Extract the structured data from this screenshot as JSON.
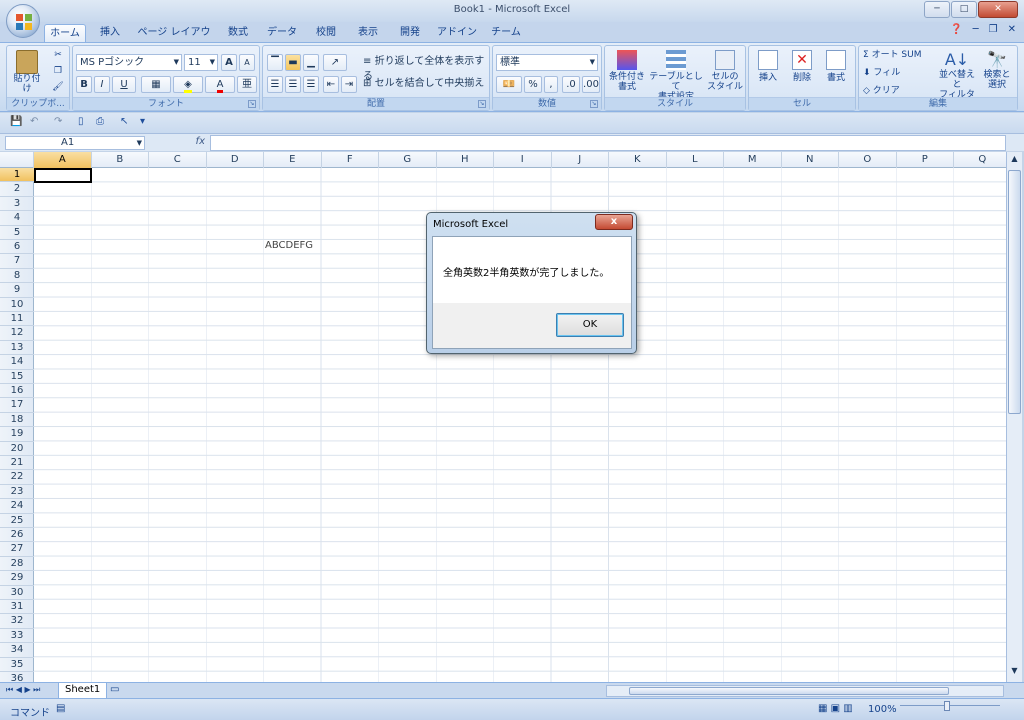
{
  "window": {
    "title": "Book1 - Microsoft Excel",
    "buttons": {
      "minimize": "─",
      "maximize": "□",
      "close": "✕"
    }
  },
  "tabs": [
    "ホーム",
    "挿入",
    "ページ レイアウト",
    "数式",
    "データ",
    "校閲",
    "表示",
    "開発",
    "アドイン",
    "チーム"
  ],
  "ribbon": {
    "clipboard": {
      "paste": "貼り付け",
      "label": "クリップボ..."
    },
    "font": {
      "name": "MS Pゴシック",
      "size": "11",
      "label": "フォント",
      "bold": "B",
      "italic": "I",
      "underline": "U",
      "grow": "A",
      "shrink": "A"
    },
    "alignment": {
      "wrap": "折り返して全体を表示する",
      "merge": "セルを結合して中央揃え",
      "label": "配置"
    },
    "number": {
      "format": "標準",
      "percent": "%",
      "comma": ",",
      "label": "数値"
    },
    "styles": {
      "conditional": "条件付き\n書式",
      "table": "テーブルとして\n書式設定",
      "cell": "セルの\nスタイル",
      "label": "スタイル"
    },
    "cells": {
      "insert": "挿入",
      "delete": "削除",
      "format": "書式",
      "label": "セル"
    },
    "editing": {
      "autosum": "オート SUM",
      "fill": "フィル",
      "clear": "クリア",
      "sort": "並べ替えと\nフィルタ",
      "find": "検索と\n選択",
      "label": "編集"
    }
  },
  "formula_bar": {
    "name_box": "A1",
    "fx": "fx",
    "value": ""
  },
  "columns": [
    "A",
    "B",
    "C",
    "D",
    "E",
    "F",
    "G",
    "H",
    "I",
    "J",
    "K",
    "L",
    "M",
    "N",
    "O",
    "P",
    "Q"
  ],
  "rows": [
    "1",
    "2",
    "3",
    "4",
    "5",
    "6",
    "7",
    "8",
    "9",
    "10",
    "11",
    "12",
    "13",
    "14",
    "15",
    "16",
    "17",
    "18",
    "19",
    "20",
    "21",
    "22",
    "23",
    "24",
    "25",
    "26",
    "27",
    "28",
    "29",
    "30",
    "31",
    "32",
    "33",
    "34",
    "35",
    "36"
  ],
  "cell_e6": "ABCDEFG",
  "sheet": {
    "tab": "Sheet1"
  },
  "status": {
    "mode": "コマンド",
    "zoom": "100%"
  },
  "dialog": {
    "title": "Microsoft Excel",
    "message": "全角英数2半角英数が完了しました。",
    "ok": "OK",
    "close": "x"
  }
}
